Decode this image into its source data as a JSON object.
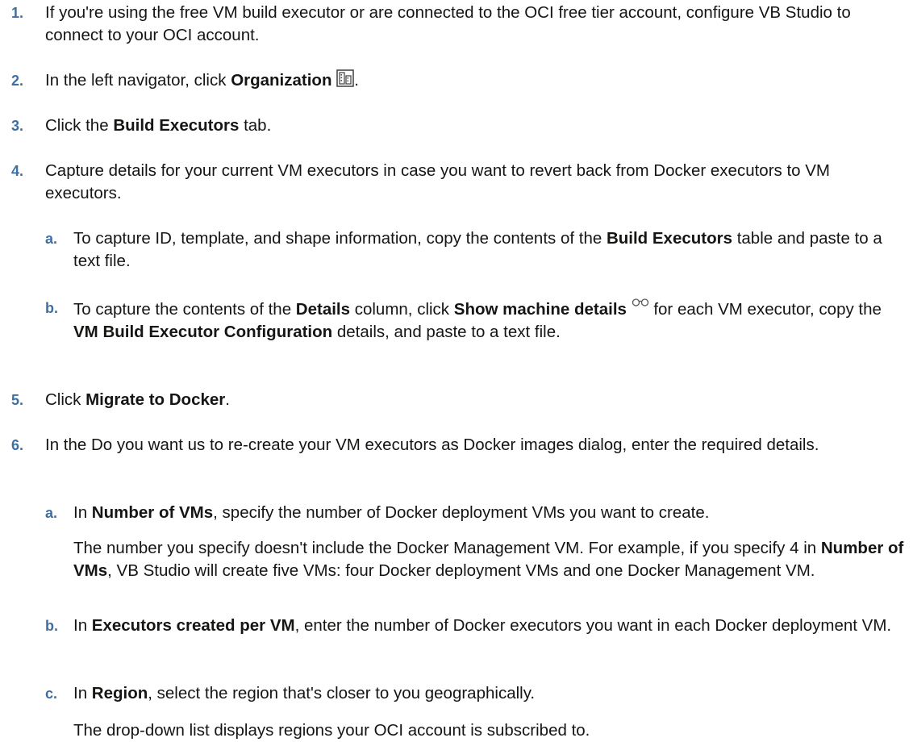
{
  "steps": [
    {
      "num": "1.",
      "text": "If you're using the free VM build executor or are connected to the OCI free tier account, configure VB Studio to connect to your OCI account."
    },
    {
      "num": "2.",
      "pre": "In the left navigator, click ",
      "bold": "Organization",
      "icon": "building-icon",
      "post": "."
    },
    {
      "num": "3.",
      "pre": "Click the ",
      "bold": "Build Executors",
      "post": " tab."
    },
    {
      "num": "4.",
      "text": "Capture details for your current VM executors in case you want to revert back from Docker executors to VM executors."
    },
    {
      "num": "5.",
      "pre": "Click ",
      "bold": "Migrate to Docker",
      "post": "."
    },
    {
      "num": "6.",
      "text": "In the Do you want us to re-create your VM executors as Docker images dialog, enter the required details."
    }
  ],
  "step4_subs": [
    {
      "letter": "a.",
      "pre": "To capture ID, template, and shape information, copy the contents of the ",
      "bold": "Build Executors",
      "post": " table and paste to a text file."
    },
    {
      "letter": "b.",
      "pre": "To capture the contents of the ",
      "bold1": "Details",
      "mid1": " column, click ",
      "bold2": "Show machine details",
      "icon": "glasses-icon",
      "mid2": " for each VM executor, copy the ",
      "bold3": "VM Build Executor Configuration",
      "post": " details, and paste to a text file."
    }
  ],
  "step6_subs": [
    {
      "letter": "a.",
      "pre": "In ",
      "bold": "Number of VMs",
      "post": ", specify the number of Docker deployment VMs you want to create.",
      "note_pre": "The number you specify doesn't include the Docker Management VM. For example, if you specify 4 in ",
      "note_bold": "Number of VMs",
      "note_post": ", VB Studio will create five VMs: four Docker deployment VMs and one Docker Management VM."
    },
    {
      "letter": "b.",
      "pre": "In ",
      "bold": "Executors created per VM",
      "post": ", enter the number of Docker executors you want in each Docker deployment VM."
    },
    {
      "letter": "c.",
      "pre": "In ",
      "bold": "Region",
      "post": ", select the region that's closer to you geographically.",
      "note": "The drop-down list displays regions your OCI account is subscribed to."
    }
  ]
}
